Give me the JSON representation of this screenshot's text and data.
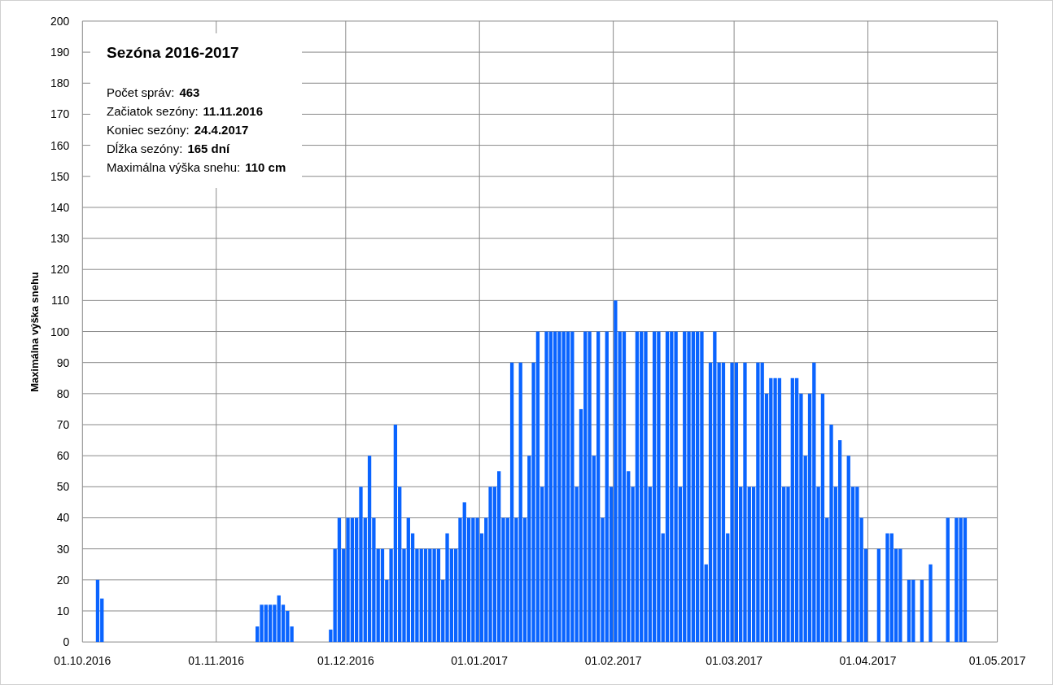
{
  "info_box": {
    "title": "Sezóna 2016-2017",
    "stats": [
      {
        "label": "Počet správ:",
        "value": "463"
      },
      {
        "label": "Začiatok sezóny:",
        "value": "11.11.2016"
      },
      {
        "label": "Koniec sezóny:",
        "value": "24.4.2017"
      },
      {
        "label": "Dĺžka sezóny:",
        "value": "165 dní"
      },
      {
        "label": "Maximálna výška snehu:",
        "value": "110 cm"
      }
    ]
  },
  "chart_data": {
    "type": "bar",
    "ylabel": "Maximálna výška snehu",
    "grid": true,
    "ylim": [
      0,
      200
    ],
    "yticks": [
      0,
      10,
      20,
      30,
      40,
      50,
      60,
      70,
      80,
      90,
      100,
      110,
      120,
      130,
      140,
      150,
      160,
      170,
      180,
      190,
      200
    ],
    "series": [
      {
        "color": "#0a64ff",
        "values": [
          0,
          0,
          0,
          20,
          14,
          0,
          0,
          0,
          0,
          0,
          0,
          0,
          0,
          0,
          0,
          0,
          0,
          0,
          0,
          0,
          0,
          0,
          0,
          0,
          0,
          0,
          0,
          0,
          0,
          0,
          0,
          0,
          0,
          0,
          0,
          0,
          0,
          0,
          0,
          0,
          5,
          12,
          12,
          12,
          12,
          15,
          12,
          10,
          5,
          0,
          0,
          0,
          0,
          0,
          0,
          0,
          0,
          4,
          30,
          40,
          30,
          40,
          40,
          40,
          50,
          40,
          60,
          40,
          30,
          30,
          20,
          30,
          70,
          50,
          30,
          40,
          35,
          30,
          30,
          30,
          30,
          30,
          30,
          20,
          35,
          30,
          30,
          40,
          45,
          40,
          40,
          40,
          35,
          40,
          50,
          50,
          55,
          40,
          40,
          90,
          40,
          90,
          40,
          60,
          90,
          100,
          50,
          100,
          100,
          100,
          100,
          100,
          100,
          100,
          50,
          75,
          100,
          100,
          60,
          100,
          40,
          100,
          50,
          110,
          100,
          100,
          55,
          50,
          100,
          100,
          100,
          50,
          100,
          100,
          35,
          100,
          100,
          100,
          50,
          100,
          100,
          100,
          100,
          100,
          25,
          90,
          100,
          90,
          90,
          35,
          90,
          90,
          50,
          90,
          50,
          50,
          90,
          90,
          80,
          85,
          85,
          85,
          50,
          50,
          85,
          85,
          80,
          60,
          80,
          90,
          50,
          80,
          40,
          70,
          50,
          65,
          0,
          60,
          50,
          50,
          40,
          30,
          0,
          0,
          30,
          0,
          35,
          35,
          30,
          30,
          0,
          20,
          20,
          0,
          20,
          0,
          25,
          0,
          0,
          0,
          40,
          0,
          40,
          40,
          40,
          0,
          0,
          0,
          0,
          0,
          0,
          0
        ]
      }
    ]
  },
  "x_axis_labels": [
    "01.10.2016",
    "01.11.2016",
    "01.12.2016",
    "01.01.2017",
    "01.02.2017",
    "01.03.2017",
    "01.04.2017",
    "01.05.2017"
  ]
}
